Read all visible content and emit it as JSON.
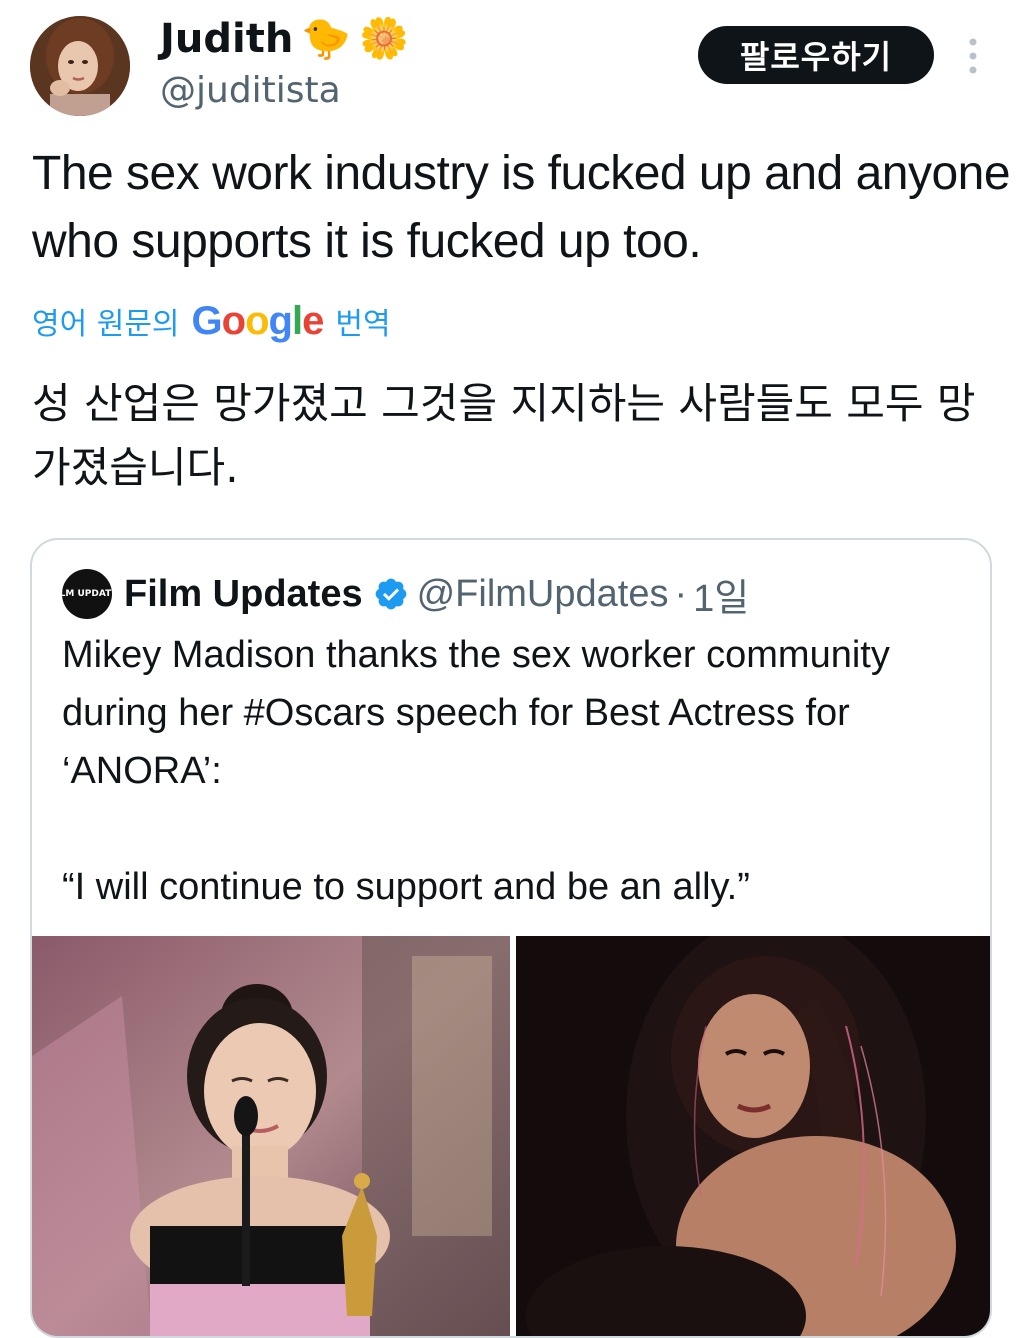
{
  "author": {
    "display_name": "Judith",
    "emoji_1": "🐤",
    "emoji_2": "🌼",
    "handle": "@juditista",
    "avatar_icon": "profile-photo"
  },
  "follow_button": {
    "label": "팔로우하기"
  },
  "more_button": {
    "icon": "vertical-dots-icon"
  },
  "tweet": {
    "text": "The sex work industry is fucked up and anyone who supports it is fucked up too."
  },
  "translation": {
    "prefix": "영어 원문의",
    "google_parts": [
      "G",
      "o",
      "o",
      "g",
      "l",
      "e"
    ],
    "suffix": "번역",
    "text": "성 산업은 망가졌고 그것을 지지하는 사람들도 모두 망가졌습니다."
  },
  "quoted_tweet": {
    "avatar_label": "FILM UPDATES",
    "display_name": "Film Updates",
    "verified": true,
    "handle": "@FilmUpdates",
    "separator": "·",
    "time": "1일",
    "text": "Mikey Madison thanks the sex worker community during her #Oscars speech for Best Actress for ‘ANORA’:\n\n“I will continue to support and be an ally.”",
    "media": [
      {
        "icon": "photo-oscars-speech"
      },
      {
        "icon": "photo-portrait"
      }
    ]
  },
  "colors": {
    "link_blue": "#1d9bf0",
    "text_primary": "#0f1419",
    "text_secondary": "#536471",
    "border": "#cfd9de",
    "verified_blue": "#1d9bf0"
  }
}
